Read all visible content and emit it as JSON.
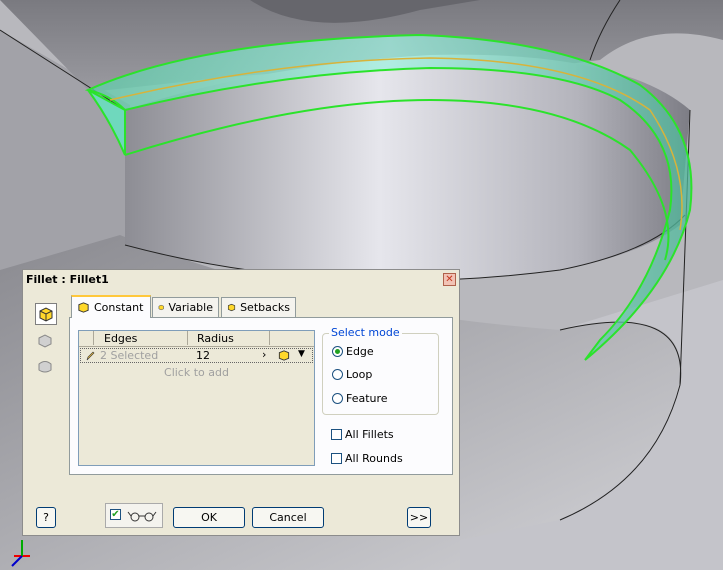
{
  "dialog": {
    "title": "Fillet : Fillet1",
    "close_label": "✕",
    "tabs": [
      {
        "label": "Constant"
      },
      {
        "label": "Variable"
      },
      {
        "label": "Setbacks"
      }
    ],
    "grid": {
      "columns": [
        "Edges",
        "Radius"
      ],
      "row": {
        "edges": "2 Selected",
        "radius": "12"
      },
      "add_hint": "Click to add"
    },
    "select_mode": {
      "title": "Select mode",
      "options": [
        "Edge",
        "Loop",
        "Feature"
      ],
      "selected": "Edge"
    },
    "checks": [
      "All Fillets",
      "All Rounds"
    ],
    "buttons": {
      "help": "?",
      "ok": "OK",
      "cancel": "Cancel",
      "more": ">>"
    }
  },
  "colors": {
    "highlight_green": "#2be32b",
    "fillet_cyan": "#7fe8d4",
    "edge_yellow": "#d8b33a",
    "tab_accent": "#ffc83c"
  }
}
